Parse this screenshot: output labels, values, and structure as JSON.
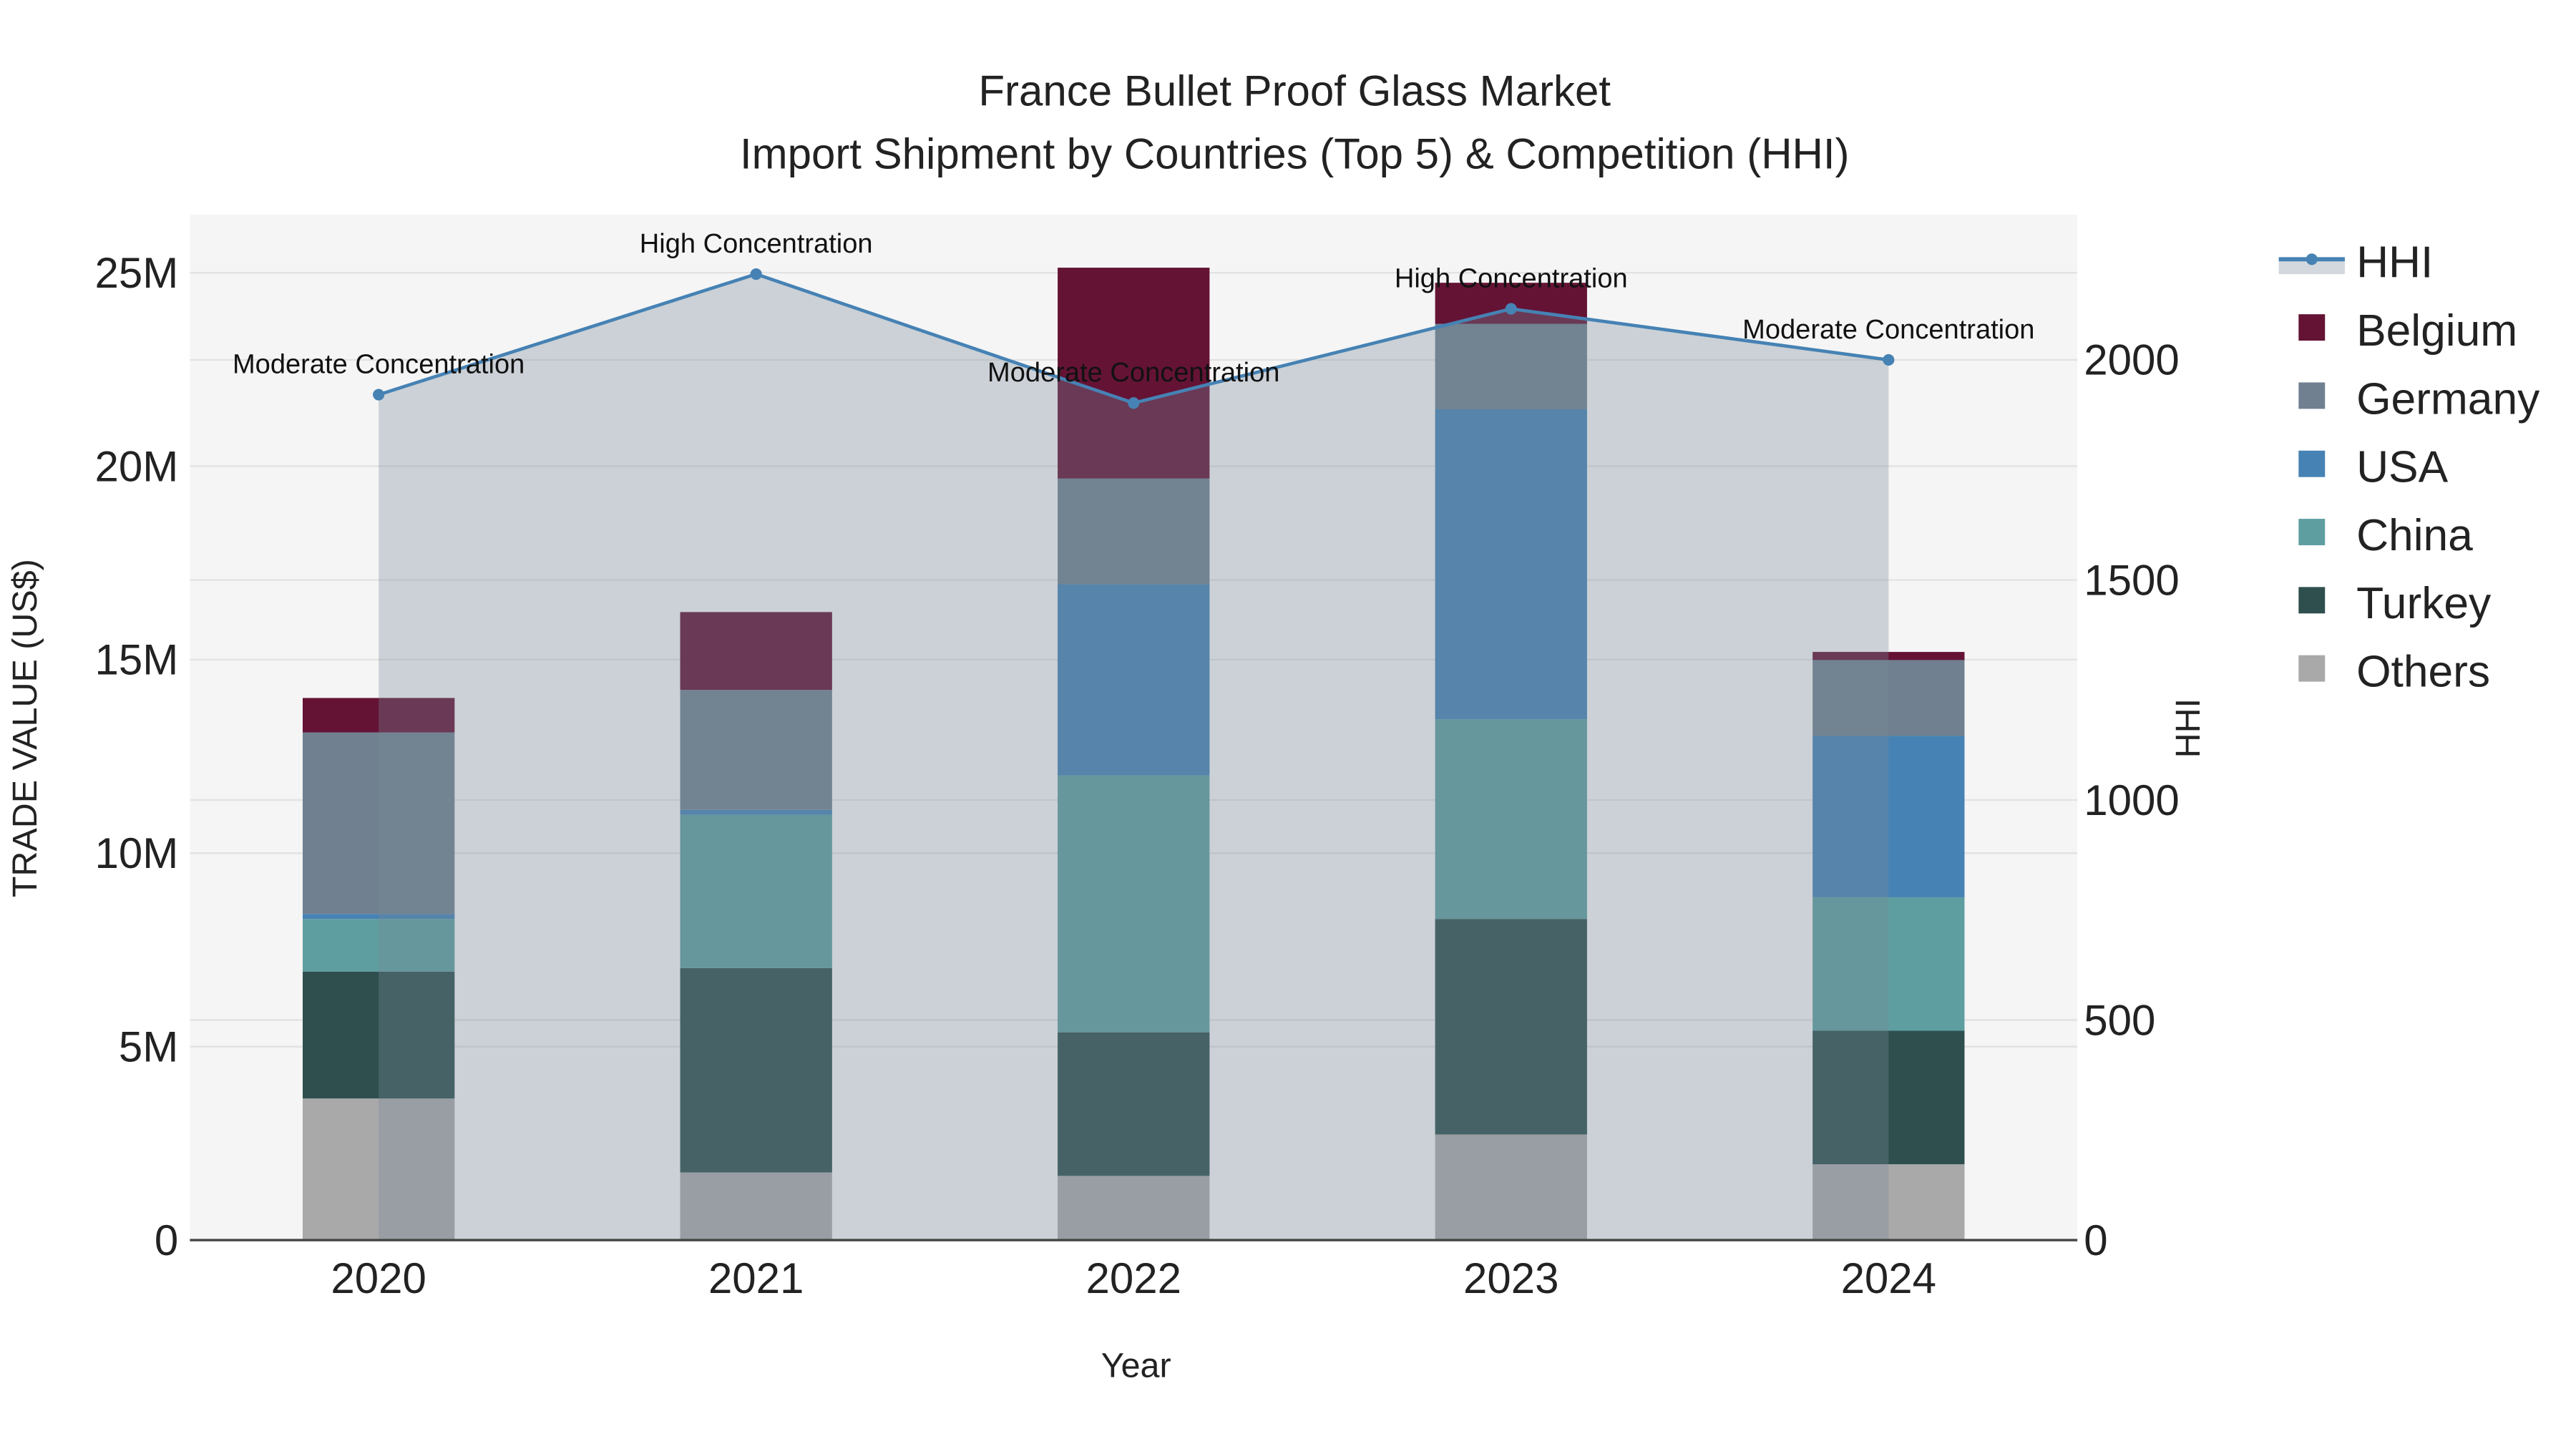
{
  "chart_data": {
    "type": "bar",
    "title": "France Bullet Proof Glass Market",
    "subtitle": "Import Shipment by Countries (Top 5) & Competition (HHI)",
    "xlabel": "Year",
    "ylabel": "TRADE VALUE (US$)",
    "y2label": "HHI",
    "categories": [
      "2020",
      "2021",
      "2022",
      "2023",
      "2024"
    ],
    "ylim": [
      0,
      26500000
    ],
    "y2lim": [
      0,
      2330
    ],
    "yticks": [
      {
        "v": 0,
        "label": "0"
      },
      {
        "v": 5000000,
        "label": "5M"
      },
      {
        "v": 10000000,
        "label": "10M"
      },
      {
        "v": 15000000,
        "label": "15M"
      },
      {
        "v": 20000000,
        "label": "20M"
      },
      {
        "v": 25000000,
        "label": "25M"
      }
    ],
    "y2ticks": [
      {
        "v": 0,
        "label": "0"
      },
      {
        "v": 500,
        "label": "500"
      },
      {
        "v": 1000,
        "label": "1000"
      },
      {
        "v": 1500,
        "label": "1500"
      },
      {
        "v": 2000,
        "label": "2000"
      }
    ],
    "grid": true,
    "legend_position": "right",
    "series": [
      {
        "name": "Others",
        "color": "#A9A9A9",
        "values": [
          3660000,
          1750000,
          1660000,
          2730000,
          1960000
        ]
      },
      {
        "name": "Turkey",
        "color": "#2F4F4F",
        "values": [
          3280000,
          5280000,
          3710000,
          5570000,
          3450000
        ]
      },
      {
        "name": "China",
        "color": "#5F9EA0",
        "values": [
          1360000,
          3960000,
          6640000,
          5160000,
          3450000
        ]
      },
      {
        "name": "USA",
        "color": "#4682B4",
        "values": [
          130000,
          130000,
          4940000,
          8010000,
          4170000
        ]
      },
      {
        "name": "Germany",
        "color": "#708090",
        "values": [
          4690000,
          3100000,
          2730000,
          2210000,
          1960000
        ]
      },
      {
        "name": "Belgium",
        "color": "#641335",
        "values": [
          890000,
          2010000,
          5450000,
          1060000,
          210000
        ]
      }
    ],
    "hhi": {
      "name": "HHI",
      "color": "#4682B4",
      "values": [
        1921,
        2195,
        1902,
        2116,
        2000
      ],
      "annotations": [
        "Moderate Concentration",
        "High Concentration",
        "Moderate Concentration",
        "High Concentration",
        "Moderate Concentration"
      ]
    },
    "legend_order": [
      "HHI",
      "Belgium",
      "Germany",
      "USA",
      "China",
      "Turkey",
      "Others"
    ]
  }
}
